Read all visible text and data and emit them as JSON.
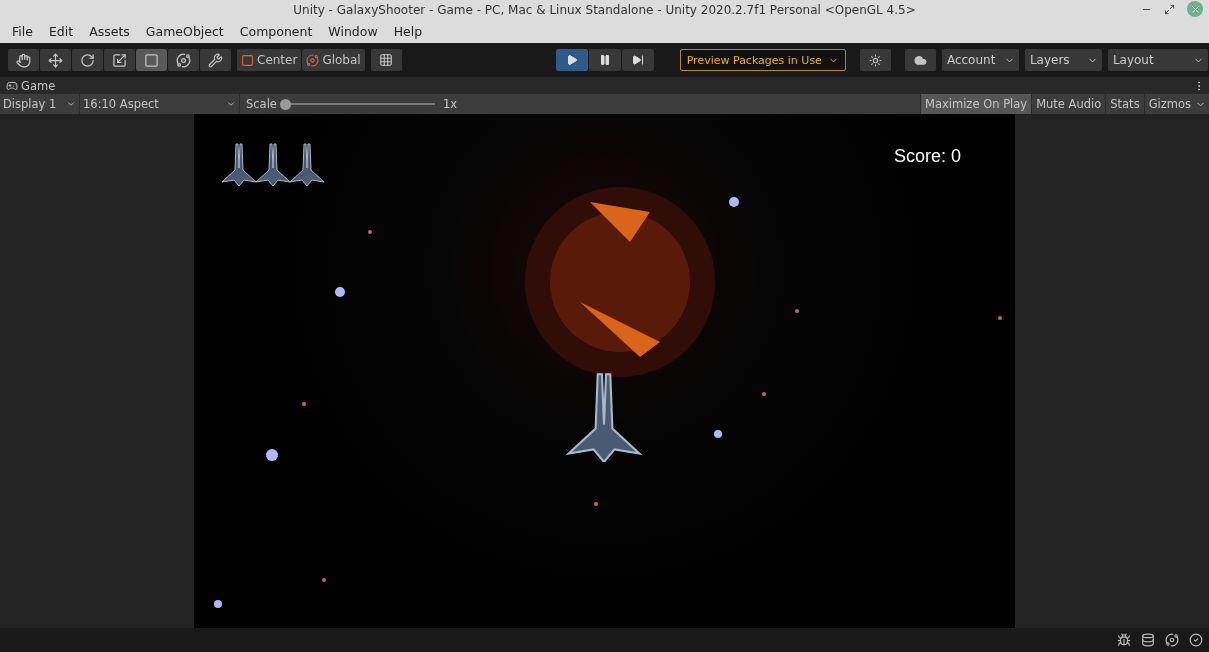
{
  "window": {
    "title": "Unity - GalaxyShooter - Game - PC, Mac & Linux Standalone - Unity 2020.2.7f1 Personal <OpenGL 4.5>"
  },
  "menu": [
    "File",
    "Edit",
    "Assets",
    "GameObject",
    "Component",
    "Window",
    "Help"
  ],
  "tools": [
    {
      "kind": "hand",
      "selected": false
    },
    {
      "kind": "move",
      "selected": false
    },
    {
      "kind": "rotate",
      "selected": false
    },
    {
      "kind": "scale",
      "selected": false
    },
    {
      "kind": "rect",
      "selected": true
    },
    {
      "kind": "transform",
      "selected": false
    },
    {
      "kind": "custom",
      "selected": false
    }
  ],
  "pivot": [
    "Center",
    "Global"
  ],
  "playback": [
    {
      "kind": "play",
      "selected": true
    },
    {
      "kind": "pause",
      "selected": false
    },
    {
      "kind": "step",
      "selected": false
    }
  ],
  "preview_packages": "Preview Packages in Use",
  "dropdowns": [
    "Account",
    "Layers",
    "Layout"
  ],
  "panel": {
    "tab": "Game"
  },
  "game_toolbar": {
    "display": "Display 1",
    "aspect": "16:10 Aspect",
    "scale_label": "Scale",
    "scale": {
      "level": 0
    },
    "scale_value": "1x",
    "toggles": [
      {
        "label": "Maximize On Play",
        "selected": true
      },
      {
        "label": "Mute Audio",
        "selected": false
      },
      {
        "label": "Stats",
        "selected": false
      },
      {
        "label": "Gizmos",
        "selected": false
      }
    ]
  },
  "game": {
    "score": "Score: 0"
  }
}
